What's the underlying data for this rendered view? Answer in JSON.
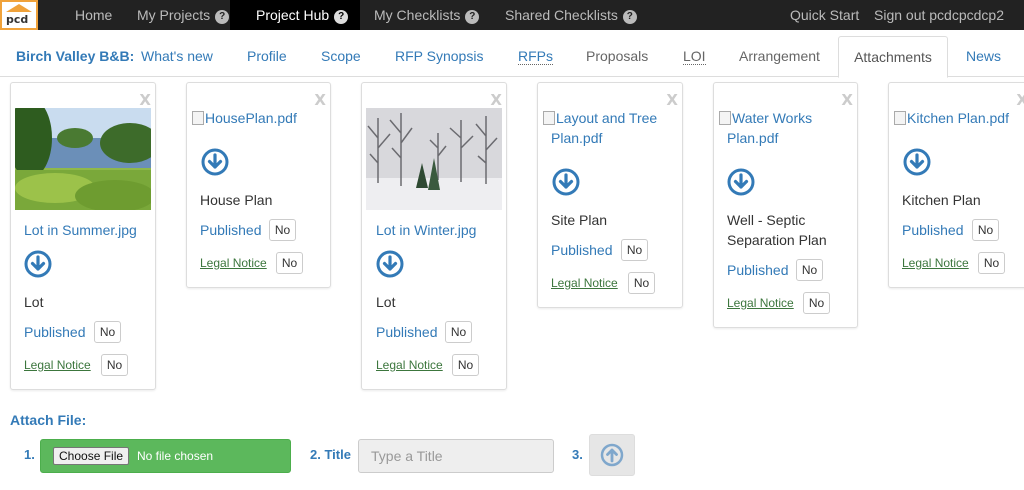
{
  "logo": {
    "text": "pcd"
  },
  "topnav": {
    "home": "Home",
    "my_projects": "My Projects",
    "project_hub": "Project Hub",
    "my_checklists": "My Checklists",
    "shared_checklists": "Shared Checklists",
    "help_glyph": "?",
    "quick_start": "Quick Start",
    "sign_out": "Sign out pcdcpcdcp2"
  },
  "tabs": {
    "project_name": "Birch Valley B&B:",
    "items": [
      "What's new",
      "Profile",
      "Scope",
      "RFP Synopsis",
      "RFPs",
      "Proposals",
      "LOI",
      "Arrangement",
      "Attachments",
      "News"
    ],
    "active": "Attachments"
  },
  "labels": {
    "close": "X",
    "published": "Published",
    "legal_notice": "Legal Notice",
    "no": "No"
  },
  "attachments": [
    {
      "file_name": "Lot in Summer.jpg",
      "description": "Lot",
      "published": "No",
      "legal_notice": "No"
    },
    {
      "file_name": "HousePlan.pdf",
      "description": "House Plan",
      "published": "No",
      "legal_notice": "No"
    },
    {
      "file_name": "Lot in Winter.jpg",
      "description": "Lot",
      "published": "No",
      "legal_notice": "No"
    },
    {
      "file_name": "Layout and Tree Plan.pdf",
      "file_name_lines": [
        "Layout and Tree",
        "Plan.pdf"
      ],
      "description": "Site Plan",
      "published": "No",
      "legal_notice": "No"
    },
    {
      "file_name": "Water Works Plan.pdf",
      "file_name_lines": [
        "Water Works",
        "Plan.pdf"
      ],
      "description": "Well - Septic Separation Plan",
      "description_lines": [
        "Well - Septic",
        "Separation Plan"
      ],
      "published": "No",
      "legal_notice": "No"
    },
    {
      "file_name": "Kitchen Plan.pdf",
      "description": "Kitchen Plan",
      "published": "No",
      "legal_notice": "No"
    }
  ],
  "attach": {
    "heading": "Attach File:",
    "step1": "1.",
    "choose_file": "Choose File",
    "no_file": "No file chosen",
    "step2": "2. Title",
    "title_placeholder": "Type a Title",
    "step3": "3."
  },
  "colors": {
    "link": "#337ab7",
    "legal_notice": "#3c763d",
    "file_area": "#5cb85c",
    "topbar": "#222222",
    "logo_accent": "#f0a23a"
  }
}
